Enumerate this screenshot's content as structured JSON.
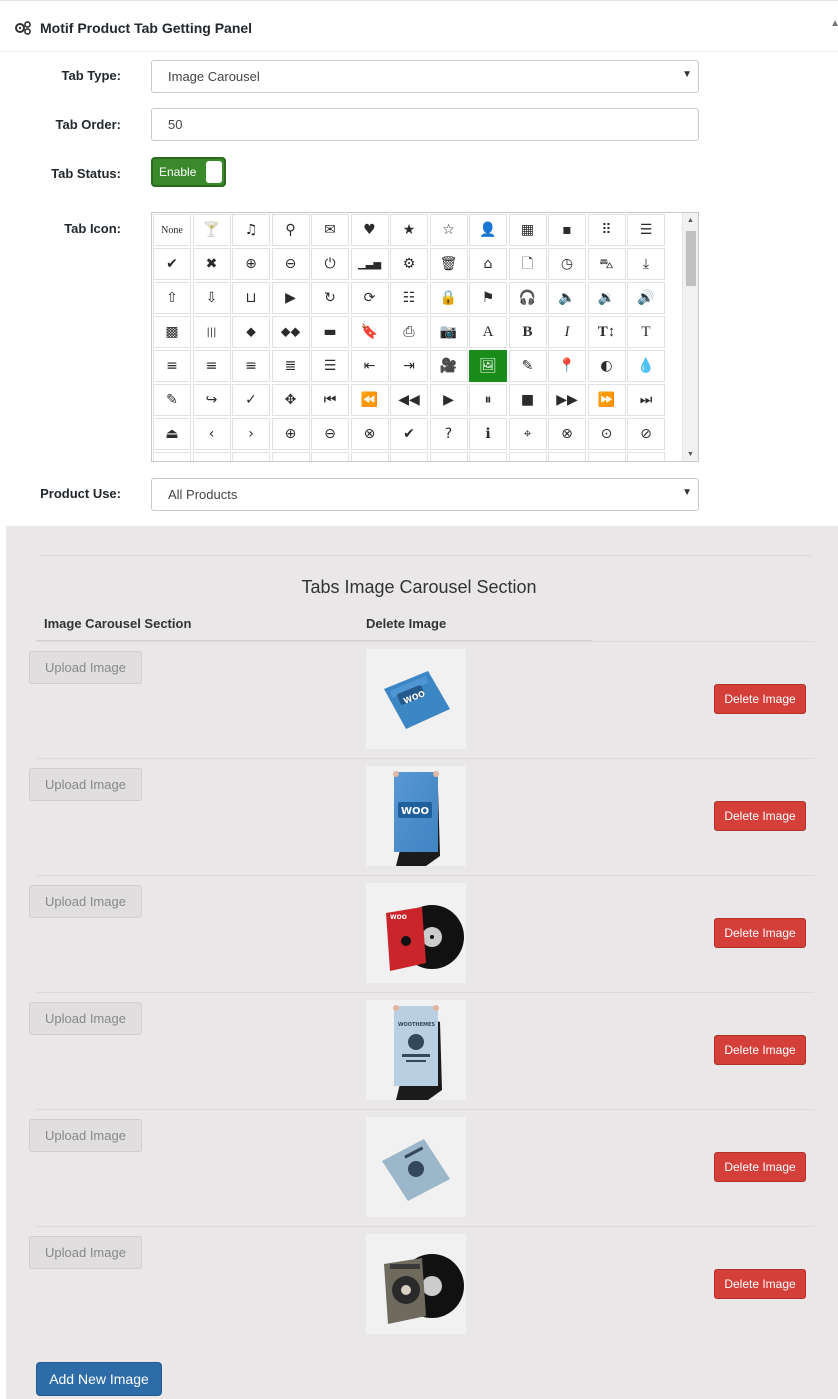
{
  "panel": {
    "title": "Motif Product Tab Getting Panel"
  },
  "form": {
    "tab_type_label": "Tab Type:",
    "tab_type_value": "Image Carousel",
    "tab_order_label": "Tab Order:",
    "tab_order_value": "50",
    "tab_status_label": "Tab Status:",
    "tab_status_value": "Enable",
    "tab_icon_label": "Tab Icon:",
    "product_use_label": "Product Use:",
    "product_use_value": "All Products"
  },
  "icons": {
    "selected": "picture",
    "cells": [
      {
        "name": "none",
        "glyph": "None"
      },
      {
        "name": "glass",
        "glyph": "🍸"
      },
      {
        "name": "music",
        "glyph": "♫"
      },
      {
        "name": "search",
        "glyph": "⚲"
      },
      {
        "name": "envelope",
        "glyph": "✉"
      },
      {
        "name": "heart",
        "glyph": "♥"
      },
      {
        "name": "star",
        "glyph": "★"
      },
      {
        "name": "star-empty",
        "glyph": "☆"
      },
      {
        "name": "user",
        "glyph": "👤"
      },
      {
        "name": "film",
        "glyph": "▦"
      },
      {
        "name": "th-large",
        "glyph": "▪"
      },
      {
        "name": "th",
        "glyph": "⠿"
      },
      {
        "name": "th-list",
        "glyph": "☰"
      },
      {
        "name": "ok",
        "glyph": "✔"
      },
      {
        "name": "remove",
        "glyph": "✖"
      },
      {
        "name": "zoom-in",
        "glyph": "⊕"
      },
      {
        "name": "zoom-out",
        "glyph": "⊖"
      },
      {
        "name": "off",
        "glyph": "⏻"
      },
      {
        "name": "signal",
        "glyph": "▁▃▅"
      },
      {
        "name": "cog",
        "glyph": "⚙"
      },
      {
        "name": "trash",
        "glyph": "🗑"
      },
      {
        "name": "home",
        "glyph": "⌂"
      },
      {
        "name": "file",
        "glyph": "🗋"
      },
      {
        "name": "time",
        "glyph": "◷"
      },
      {
        "name": "road",
        "glyph": "⛍"
      },
      {
        "name": "download-alt",
        "glyph": "⤓"
      },
      {
        "name": "upload",
        "glyph": "⇧"
      },
      {
        "name": "download",
        "glyph": "⇩"
      },
      {
        "name": "inbox",
        "glyph": "⊔"
      },
      {
        "name": "play-circle",
        "glyph": "▶"
      },
      {
        "name": "repeat",
        "glyph": "↻"
      },
      {
        "name": "refresh",
        "glyph": "⟳"
      },
      {
        "name": "list-alt",
        "glyph": "☷"
      },
      {
        "name": "lock",
        "glyph": "🔒"
      },
      {
        "name": "flag",
        "glyph": "⚑"
      },
      {
        "name": "headphones",
        "glyph": "🎧"
      },
      {
        "name": "volume-off",
        "glyph": "🔈"
      },
      {
        "name": "volume-down",
        "glyph": "🔉"
      },
      {
        "name": "volume-up",
        "glyph": "🔊"
      },
      {
        "name": "qrcode",
        "glyph": "▩"
      },
      {
        "name": "barcode",
        "glyph": "|||"
      },
      {
        "name": "tag",
        "glyph": "⬥"
      },
      {
        "name": "tags",
        "glyph": "⬥⬥"
      },
      {
        "name": "book",
        "glyph": "▬"
      },
      {
        "name": "bookmark",
        "glyph": "🔖"
      },
      {
        "name": "print",
        "glyph": "⎙"
      },
      {
        "name": "camera",
        "glyph": "📷"
      },
      {
        "name": "font",
        "glyph": "A"
      },
      {
        "name": "bold",
        "glyph": "B"
      },
      {
        "name": "italic",
        "glyph": "I"
      },
      {
        "name": "text-height",
        "glyph": "T↕"
      },
      {
        "name": "text-width",
        "glyph": "T"
      },
      {
        "name": "align-left",
        "glyph": "≡"
      },
      {
        "name": "align-center",
        "glyph": "≡"
      },
      {
        "name": "align-right",
        "glyph": "≡"
      },
      {
        "name": "align-justify",
        "glyph": "≣"
      },
      {
        "name": "list",
        "glyph": "☰"
      },
      {
        "name": "indent-left",
        "glyph": "⇤"
      },
      {
        "name": "indent-right",
        "glyph": "⇥"
      },
      {
        "name": "facetime-video",
        "glyph": "🎥"
      },
      {
        "name": "picture",
        "glyph": "🖼"
      },
      {
        "name": "pencil",
        "glyph": "✎"
      },
      {
        "name": "map-marker",
        "glyph": "📍"
      },
      {
        "name": "adjust",
        "glyph": "◐"
      },
      {
        "name": "tint",
        "glyph": "💧"
      },
      {
        "name": "edit",
        "glyph": "✎"
      },
      {
        "name": "share",
        "glyph": "↪"
      },
      {
        "name": "check",
        "glyph": "✓"
      },
      {
        "name": "move",
        "glyph": "✥"
      },
      {
        "name": "step-backward",
        "glyph": "⏮"
      },
      {
        "name": "fast-backward",
        "glyph": "⏪"
      },
      {
        "name": "backward",
        "glyph": "◀◀"
      },
      {
        "name": "play",
        "glyph": "▶"
      },
      {
        "name": "pause",
        "glyph": "⏸"
      },
      {
        "name": "stop",
        "glyph": "■"
      },
      {
        "name": "forward",
        "glyph": "▶▶"
      },
      {
        "name": "fast-forward",
        "glyph": "⏩"
      },
      {
        "name": "step-forward",
        "glyph": "⏭"
      },
      {
        "name": "eject",
        "glyph": "⏏"
      },
      {
        "name": "chevron-left",
        "glyph": "‹"
      },
      {
        "name": "chevron-right",
        "glyph": "›"
      },
      {
        "name": "plus-sign",
        "glyph": "⊕"
      },
      {
        "name": "minus-sign",
        "glyph": "⊖"
      },
      {
        "name": "remove-sign",
        "glyph": "⊗"
      },
      {
        "name": "ok-sign",
        "glyph": "✔"
      },
      {
        "name": "question-sign",
        "glyph": "?"
      },
      {
        "name": "info-sign",
        "glyph": "ℹ"
      },
      {
        "name": "screenshot",
        "glyph": "⌖"
      },
      {
        "name": "remove-circle",
        "glyph": "⊗"
      },
      {
        "name": "ok-circle",
        "glyph": "⊙"
      },
      {
        "name": "ban-circle",
        "glyph": "⊘"
      }
    ]
  },
  "carousel": {
    "title": "Tabs Image Carousel Section",
    "col_section": "Image Carousel Section",
    "col_delete": "Delete Image",
    "upload_label": "Upload Image",
    "delete_label": "Delete Image",
    "add_label": "Add New Image",
    "rows": [
      {
        "image": "woo-flyer-tilted",
        "text": "WOO"
      },
      {
        "image": "woo-poster-held",
        "text": "WOO"
      },
      {
        "image": "vinyl-record-red",
        "text": "WOO"
      },
      {
        "image": "poster-woothemes-held",
        "text": "WOOTHEMES"
      },
      {
        "image": "flyer-tilted-light",
        "text": ""
      },
      {
        "image": "vinyl-record-dark",
        "text": ""
      }
    ]
  },
  "colors": {
    "accent_green": "#1a8c1a",
    "delete_red": "#d43f3a",
    "add_blue": "#2d6ca8",
    "section_bg": "#e9e7e7"
  }
}
